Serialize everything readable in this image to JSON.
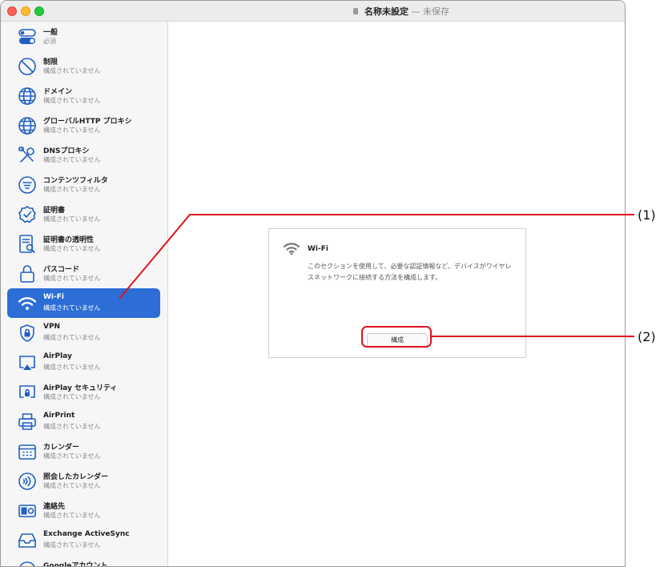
{
  "window": {
    "title": "名称未設定",
    "separator": "—",
    "status": "未保存"
  },
  "sidebar": {
    "selected_index": 9,
    "items": [
      {
        "icon": "toggle-icon",
        "label": "一般",
        "sub": "必須"
      },
      {
        "icon": "restrictions-icon",
        "label": "制限",
        "sub": "構成されていません"
      },
      {
        "icon": "globe-icon",
        "label": "ドメイン",
        "sub": "構成されていません"
      },
      {
        "icon": "globe-icon",
        "label": "グローバルHTTP プロキシ",
        "sub": "構成されていません"
      },
      {
        "icon": "tools-icon",
        "label": "DNSプロキシ",
        "sub": "構成されていません"
      },
      {
        "icon": "filter-icon",
        "label": "コンテンツフィルタ",
        "sub": "構成されていません"
      },
      {
        "icon": "certificate-icon",
        "label": "証明書",
        "sub": "構成されていません"
      },
      {
        "icon": "certificate-transparency-icon",
        "label": "証明書の透明性",
        "sub": "構成されていません"
      },
      {
        "icon": "lock-icon",
        "label": "パスコード",
        "sub": "構成されていません"
      },
      {
        "icon": "wifi-icon",
        "label": "Wi-Fi",
        "sub": "構成されていません"
      },
      {
        "icon": "vpn-shield-icon",
        "label": "VPN",
        "sub": "構成されていません"
      },
      {
        "icon": "airplay-icon",
        "label": "AirPlay",
        "sub": "構成されていません"
      },
      {
        "icon": "airplay-security-icon",
        "label": "AirPlay セキュリティ",
        "sub": "構成されていません"
      },
      {
        "icon": "printer-icon",
        "label": "AirPrint",
        "sub": "構成されていません"
      },
      {
        "icon": "calendar-icon",
        "label": "カレンダー",
        "sub": "構成されていません"
      },
      {
        "icon": "subscribed-calendar-icon",
        "label": "照会したカレンダー",
        "sub": "構成されていません"
      },
      {
        "icon": "contacts-icon",
        "label": "連絡先",
        "sub": "構成されていません"
      },
      {
        "icon": "mail-tray-icon",
        "label": "Exchange ActiveSync",
        "sub": "構成されていません"
      },
      {
        "icon": "google-account-icon",
        "label": "Googleアカウント",
        "sub": ""
      }
    ]
  },
  "card": {
    "icon": "wifi-icon",
    "title": "Wi-Fi",
    "description": "このセクションを使用して、必要な認証情報など、デバイスがワイヤレスネットワークに接続する方法を構成します。",
    "button_label": "構成"
  },
  "callouts": {
    "one": "(1)",
    "two": "(2)",
    "color": "#e01020"
  },
  "colors": {
    "selection": "#2c6ed6",
    "icon_blue": "#1f5fc4"
  }
}
